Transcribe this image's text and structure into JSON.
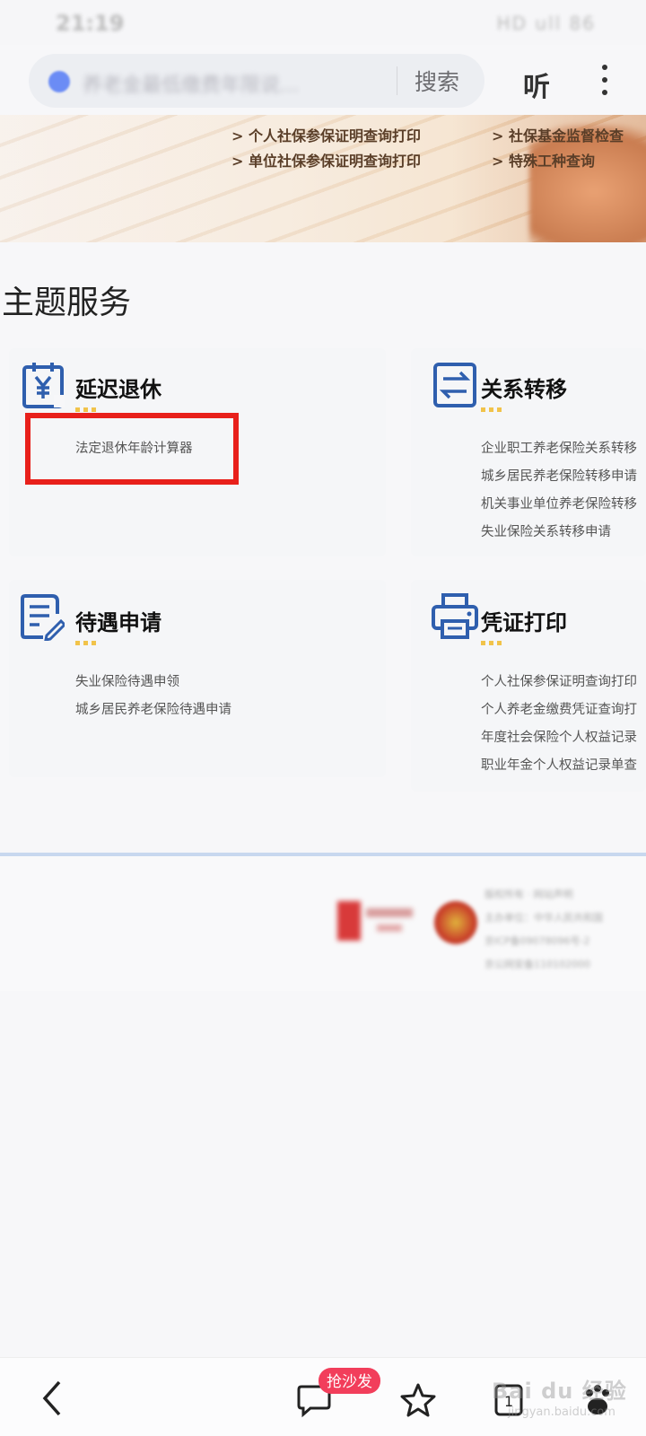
{
  "status_bar": {
    "time": "21:19",
    "icons": "HD ull 86"
  },
  "search": {
    "query": "养老金最低缴费年限说...",
    "button": "搜索"
  },
  "header": {
    "listen": "听"
  },
  "banner": {
    "links": [
      "> 个人社保参保证明查询打印",
      "> 社保基金监督检查",
      "> 单位社保参保证明查询打印",
      "> 特殊工种查询"
    ]
  },
  "section_title": "主题服务",
  "cards": [
    {
      "icon": "yuan-calendar-icon",
      "title": "延迟退休",
      "items": [
        "法定退休年龄计算器"
      ]
    },
    {
      "icon": "transfer-arrows-icon",
      "title": "关系转移",
      "items": [
        "企业职工养老保险关系转移",
        "城乡居民养老保险转移申请",
        "机关事业单位养老保险转移",
        "失业保险关系转移申请"
      ]
    },
    {
      "icon": "form-edit-icon",
      "title": "待遇申请",
      "items": [
        "失业保险待遇申领",
        "城乡居民养老保险待遇申请"
      ]
    },
    {
      "icon": "printer-icon",
      "title": "凭证打印",
      "items": [
        "个人社保参保证明查询打印",
        "个人养老金缴费凭证查询打",
        "年度社会保险个人权益记录",
        "职业年金个人权益记录单查"
      ]
    }
  ],
  "footer": {
    "text": [
      "版权所有  ·  网站声明",
      "主办单位：中华人民共和国",
      "京ICP备09078096号-2",
      "京公网安备110102000"
    ]
  },
  "bottom_nav": {
    "sofa_badge": "抢沙发"
  },
  "watermark": {
    "main": "Bai du 经验",
    "sub": "jingyan.baidu.com"
  },
  "colors": {
    "accent_blue": "#2f5fae",
    "highlight_red": "#e8201b",
    "badge_pink": "#f23e5b",
    "dots_yellow": "#f1c34a"
  }
}
